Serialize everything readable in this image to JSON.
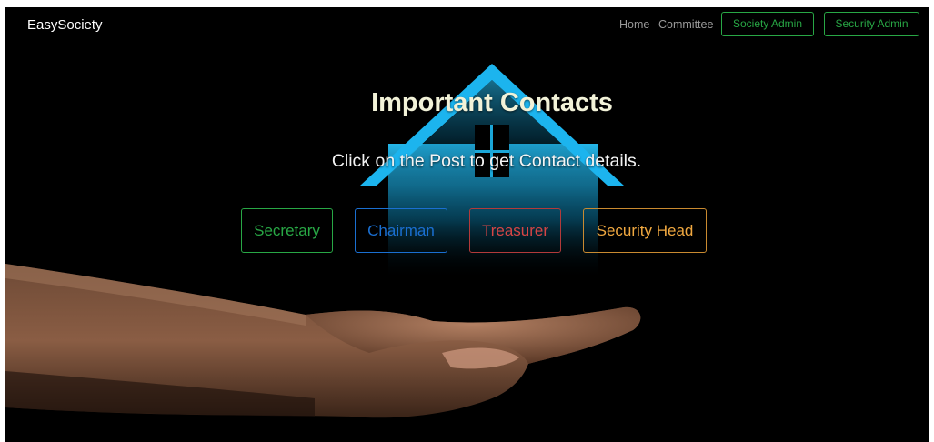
{
  "navbar": {
    "brand": "EasySociety",
    "links": [
      "Home",
      "Committee"
    ],
    "buttons": [
      "Society Admin",
      "Security Admin"
    ]
  },
  "hero": {
    "title": "Important Contacts",
    "subtitle": "Click on the Post to get Contact details."
  },
  "posts": [
    {
      "label": "Secretary",
      "color": "#28a745"
    },
    {
      "label": "Chairman",
      "color": "#1a6fd1"
    },
    {
      "label": "Treasurer",
      "color": "#d64545"
    },
    {
      "label": "Security Head",
      "color": "#f0a840"
    }
  ],
  "colors": {
    "background": "#000000",
    "house_accent": "#1cb4ee",
    "brand_green": "#28a745"
  }
}
